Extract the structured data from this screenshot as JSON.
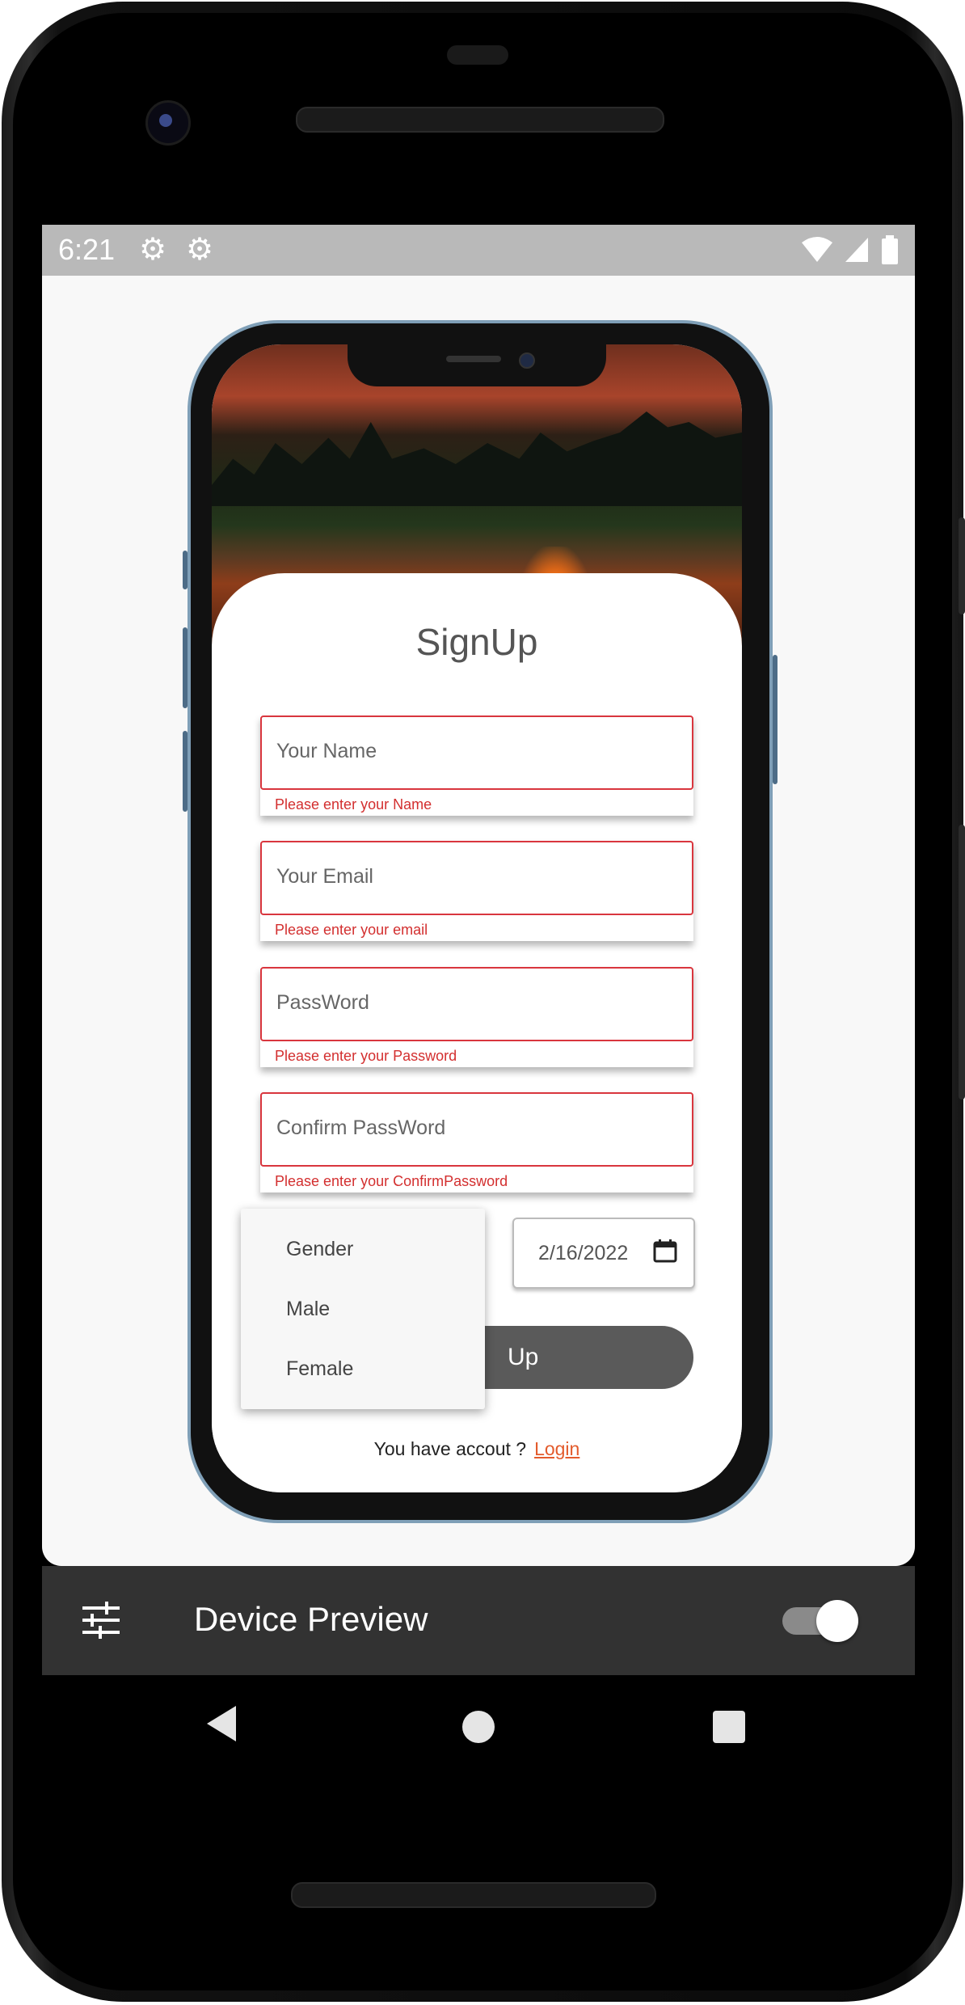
{
  "status_bar": {
    "time": "6:21",
    "icons": [
      "gear-icon",
      "gear-icon",
      "wifi-icon",
      "signal-icon",
      "battery-icon"
    ]
  },
  "form": {
    "title": "SignUp",
    "fields": [
      {
        "placeholder": "Your Name",
        "error": "Please enter your Name"
      },
      {
        "placeholder": "Your Email",
        "error": "Please enter your email"
      },
      {
        "placeholder": "PassWord",
        "error": "Please enter your Password"
      },
      {
        "placeholder": "Confirm PassWord",
        "error": "Please enter your ConfirmPassword"
      }
    ],
    "gender_options": [
      "Gender",
      "Male",
      "Female"
    ],
    "date_value": "2/16/2022",
    "signup_button_visible_text": "Up",
    "login_prompt": "You have accout ?",
    "login_link": "Login"
  },
  "device_preview": {
    "title": "Device Preview",
    "toggle_on": true
  },
  "colors": {
    "error": "#d32f2f",
    "link": "#e35b2c",
    "button": "#5a5a5a",
    "preview_bar": "#323232"
  }
}
